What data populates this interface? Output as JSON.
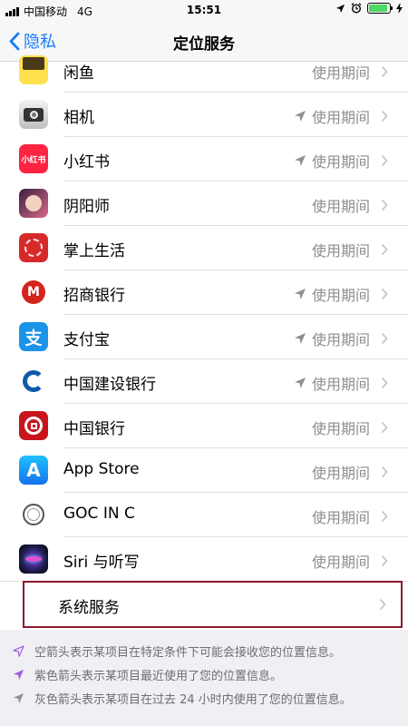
{
  "status": {
    "carrier": "中国移动",
    "network": "4G",
    "time": "15:51",
    "battery_level": 0.9
  },
  "nav": {
    "back_label": "隐私",
    "title": "定位服务"
  },
  "apps": [
    {
      "name": "闲鱼",
      "permission": "使用期间",
      "arrow": "none",
      "icon": "xianyu-icon"
    },
    {
      "name": "相机",
      "permission": "使用期间",
      "arrow": "gray",
      "icon": "camera-icon"
    },
    {
      "name": "小红书",
      "permission": "使用期间",
      "arrow": "gray",
      "icon": "xiaohongshu-icon",
      "icon_text": "小红书"
    },
    {
      "name": "阴阳师",
      "permission": "使用期间",
      "arrow": "none",
      "icon": "onmyoji-icon"
    },
    {
      "name": "掌上生活",
      "permission": "使用期间",
      "arrow": "none",
      "icon": "zhangshang-shenghuo-icon"
    },
    {
      "name": "招商银行",
      "permission": "使用期间",
      "arrow": "gray",
      "icon": "cmb-icon"
    },
    {
      "name": "支付宝",
      "permission": "使用期间",
      "arrow": "gray",
      "icon": "alipay-icon"
    },
    {
      "name": "中国建设银行",
      "permission": "使用期间",
      "arrow": "gray",
      "icon": "ccb-icon"
    },
    {
      "name": "中国银行",
      "permission": "使用期间",
      "arrow": "none",
      "icon": "boc-icon"
    },
    {
      "name": "App Store",
      "permission": "使用期间",
      "arrow": "none",
      "icon": "app-store-icon"
    },
    {
      "name": "GOC IN C",
      "permission": "使用期间",
      "arrow": "none",
      "icon": "goc-icon"
    },
    {
      "name": "Siri 与听写",
      "permission": "使用期间",
      "arrow": "none",
      "icon": "siri-icon"
    }
  ],
  "system_services": {
    "label": "系统服务"
  },
  "legend": [
    {
      "text": "空箭头表示某项目在特定条件下可能会接收您的位置信息。",
      "icon": "hollow-arrow-icon"
    },
    {
      "text": "紫色箭头表示某项目最近使用了您的位置信息。",
      "icon": "purple-arrow-icon"
    },
    {
      "text": "灰色箭头表示某项目在过去 24 小时内使用了您的位置信息。",
      "icon": "gray-arrow-icon"
    }
  ],
  "colors": {
    "accent": "#1a7dfb",
    "purple": "#a45ce0",
    "gray_arrow": "#8e8e93",
    "highlight": "#8b1a2c"
  }
}
